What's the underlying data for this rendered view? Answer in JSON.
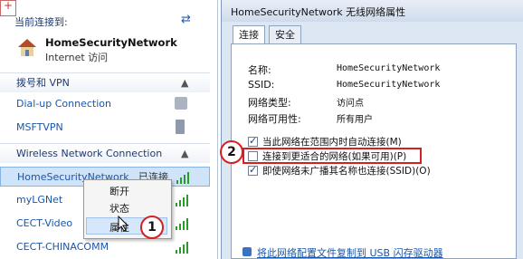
{
  "network_panel": {
    "current_header": "当前连接到:",
    "current_network": {
      "name": "HomeSecurityNetwork",
      "status": "Internet 访问"
    },
    "dialup_header": "拨号和 VPN",
    "dialup_items": [
      "Dial-up Connection",
      "MSFTVPN"
    ],
    "wireless_header": "Wireless Network Connection",
    "wireless_items": [
      {
        "name": "HomeSecurityNetwork",
        "status": "已连接"
      },
      {
        "name": "myLGNet",
        "status": ""
      },
      {
        "name": "CECT-Video",
        "status": ""
      },
      {
        "name": "CECT-CHINACOMM",
        "status": ""
      }
    ]
  },
  "context_menu": {
    "items": [
      "断开",
      "状态",
      "属性"
    ]
  },
  "dialog": {
    "title": "HomeSecurityNetwork 无线网络属性",
    "tabs": [
      "连接",
      "安全"
    ],
    "fields": [
      {
        "label": "名称:",
        "value": "HomeSecurityNetwork"
      },
      {
        "label": "SSID:",
        "value": "HomeSecurityNetwork"
      },
      {
        "label": "网络类型:",
        "value": "访问点"
      },
      {
        "label": "网络可用性:",
        "value": "所有用户"
      }
    ],
    "options": [
      {
        "label": "当此网络在范围内时自动连接(M)",
        "checked": true
      },
      {
        "label": "连接到更适合的网络(如果可用)(P)",
        "checked": false
      },
      {
        "label": "即使网络未广播其名称也连接(SSID)(O)",
        "checked": true
      }
    ],
    "bottom_link": "将此网络配置文件复制到 USB 闪存驱动器"
  },
  "callouts": [
    "1",
    "2"
  ],
  "colors": {
    "highlight": "#d42020",
    "link": "#1a56a8",
    "selected_bg": "#cfe3f9"
  }
}
